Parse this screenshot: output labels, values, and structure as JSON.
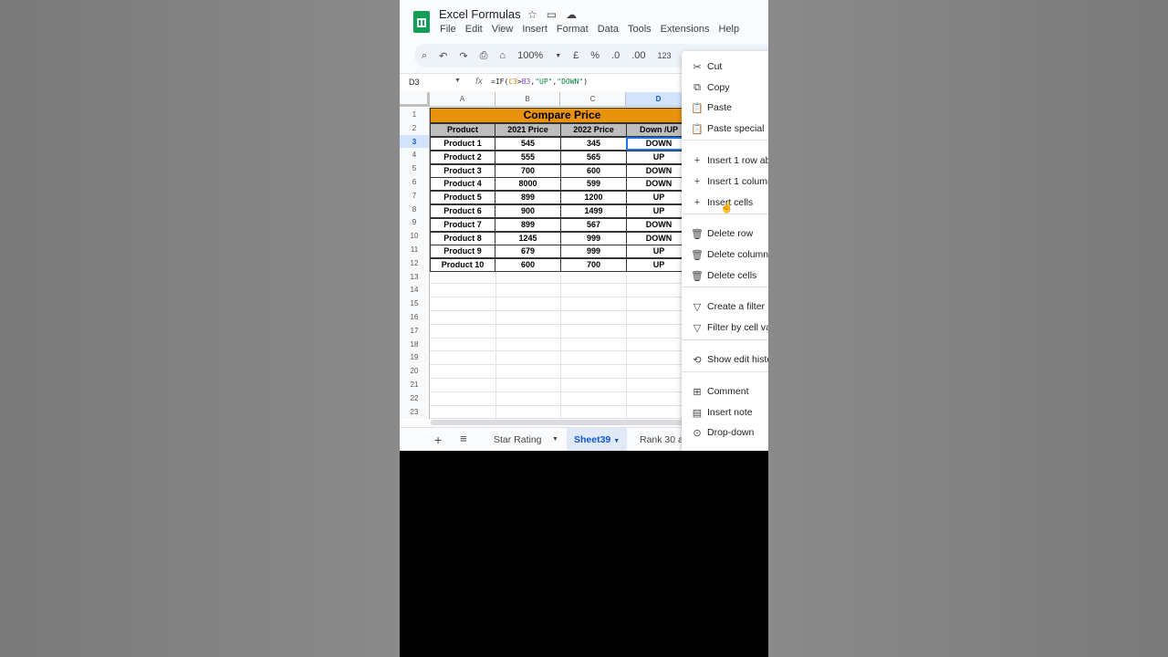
{
  "app": {
    "title": "Excel Formulas",
    "menu": [
      "File",
      "Edit",
      "View",
      "Insert",
      "Format",
      "Data",
      "Tools",
      "Extensions",
      "Help"
    ],
    "toolbar": {
      "zoom": "100%",
      "currency": "£",
      "percent": "%",
      "dec_less": ".0",
      "dec_more": ".00",
      "format_123": "123"
    }
  },
  "formula_bar": {
    "cell_ref": "D3",
    "fx": "fx",
    "formula_parts": [
      "=IF(",
      "C3",
      ">",
      "B3",
      ",",
      "\"UP\"",
      ",",
      "\"DOWN\"",
      ")"
    ]
  },
  "grid": {
    "columns": [
      "A",
      "B",
      "C",
      "D"
    ],
    "rows": [
      "1",
      "2",
      "3",
      "4",
      "5",
      "6",
      "7",
      "8",
      "9",
      "10",
      "11",
      "12",
      "13",
      "14",
      "15",
      "16",
      "17",
      "18",
      "19",
      "20",
      "21",
      "22",
      "23"
    ],
    "table_title": "Compare Price",
    "headers": [
      "Product",
      "2021 Price",
      "2022 Price",
      "Down /UP"
    ],
    "data": [
      [
        "Product 1",
        "545",
        "345",
        "DOWN"
      ],
      [
        "Product 2",
        "555",
        "565",
        "UP"
      ],
      [
        "Product 3",
        "700",
        "600",
        "DOWN"
      ],
      [
        "Product 4",
        "8000",
        "599",
        "DOWN"
      ],
      [
        "Product 5",
        "899",
        "1200",
        "UP"
      ],
      [
        "Product 6",
        "900",
        "1499",
        "UP"
      ],
      [
        "Product 7",
        "899",
        "567",
        "DOWN"
      ],
      [
        "Product 8",
        "1245",
        "999",
        "DOWN"
      ],
      [
        "Product 9",
        "679",
        "999",
        "UP"
      ],
      [
        "Product 10",
        "600",
        "700",
        "UP"
      ]
    ]
  },
  "tabs": {
    "plus": "+",
    "list": "≡",
    "items": [
      "Star Rating",
      "Sheet39",
      "Rank 30 a"
    ],
    "active": "Sheet39"
  },
  "context_menu": {
    "items": [
      {
        "icon": "scissors-icon",
        "glyph": "✂",
        "label": "Cut"
      },
      {
        "icon": "copy-icon",
        "glyph": "⧉",
        "label": "Copy"
      },
      {
        "icon": "paste-icon",
        "glyph": "📋",
        "label": "Paste"
      },
      {
        "icon": "paste-special-icon",
        "glyph": "📋",
        "label": "Paste special"
      },
      {
        "icon": "plus-icon",
        "glyph": "+",
        "label": "Insert 1 row ab"
      },
      {
        "icon": "plus-icon",
        "glyph": "+",
        "label": "Insert 1 column"
      },
      {
        "icon": "plus-icon",
        "glyph": "+",
        "label": "Insert cells"
      },
      {
        "icon": "trash-icon",
        "glyph": "🗑",
        "label": "Delete row"
      },
      {
        "icon": "trash-icon",
        "glyph": "🗑",
        "label": "Delete column"
      },
      {
        "icon": "trash-icon",
        "glyph": "🗑",
        "label": "Delete cells"
      },
      {
        "icon": "filter-icon",
        "glyph": "▽",
        "label": "Create a filter"
      },
      {
        "icon": "filter-icon",
        "glyph": "▽",
        "label": "Filter by cell va"
      },
      {
        "icon": "history-icon",
        "glyph": "⟲",
        "label": "Show edit histo"
      },
      {
        "icon": "comment-icon",
        "glyph": "⊞",
        "label": "Comment"
      },
      {
        "icon": "note-icon",
        "glyph": "▤",
        "label": "Insert note"
      },
      {
        "icon": "dropdown-icon",
        "glyph": "⊙",
        "label": "Drop-down"
      }
    ]
  },
  "colors": {
    "title_bg": "#e8930b",
    "header_bg": "#bdbdbd",
    "accent": "#0b57d0",
    "brand": "#0f9d58"
  }
}
